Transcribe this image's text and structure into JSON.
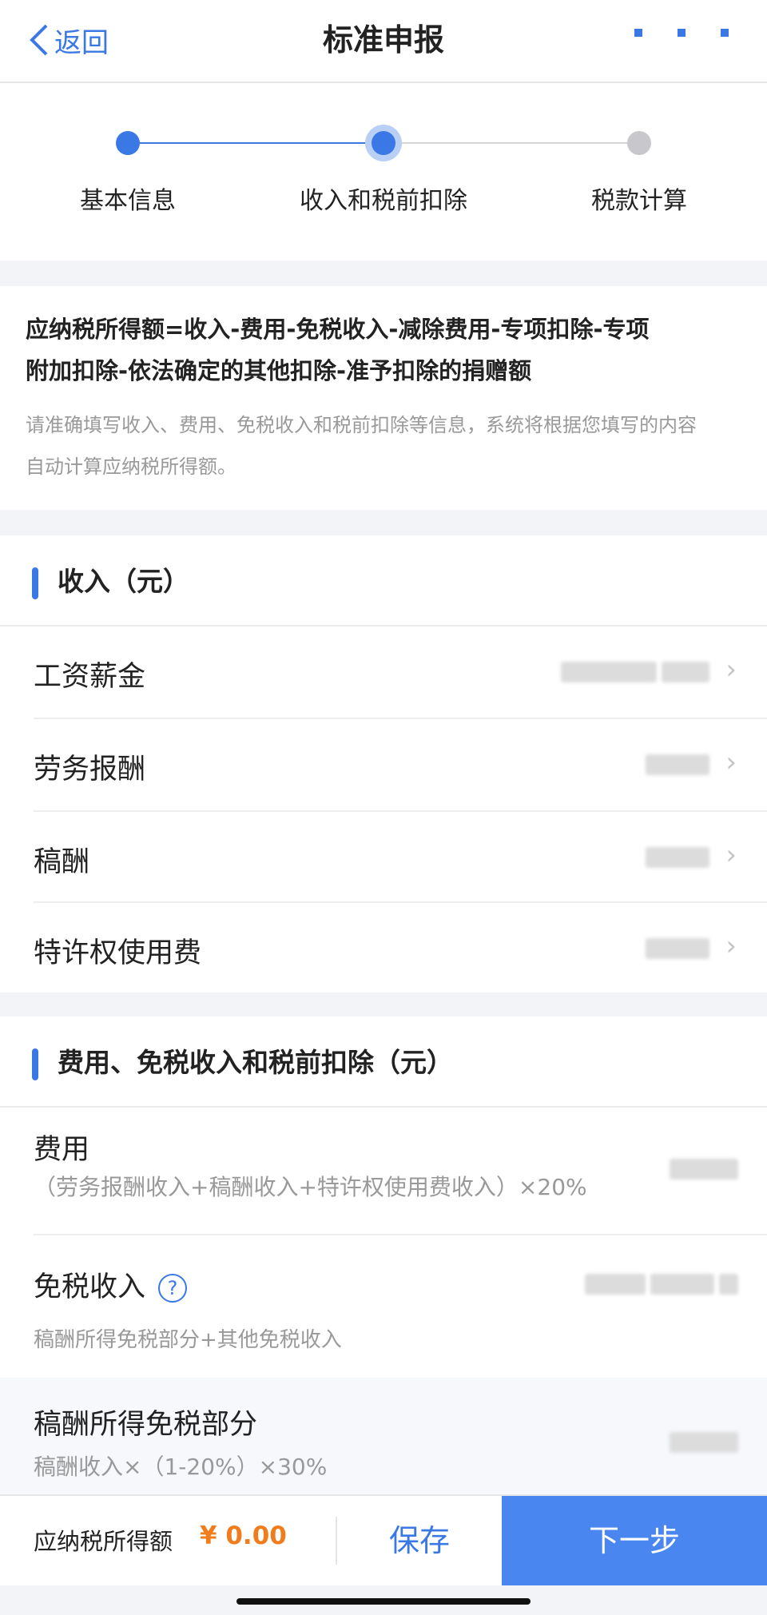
{
  "header": {
    "back_label": "返回",
    "title": "标准申报"
  },
  "steps": [
    {
      "label": "基本信息",
      "state": "done"
    },
    {
      "label": "收入和税前扣除",
      "state": "current"
    },
    {
      "label": "税款计算",
      "state": "todo"
    }
  ],
  "formula": {
    "line1": "应纳税所得额=收入-费用-免税收入-减除费用-专项扣除-专项",
    "line2": "附加扣除-依法确定的其他扣除-准予扣除的捐赠额",
    "hint1": "请准确填写收入、费用、免税收入和税前扣除等信息，系统将根据您填写的内容",
    "hint2": "自动计算应纳税所得额。"
  },
  "income": {
    "title": "收入（元）",
    "items": [
      {
        "label": "工资薪金"
      },
      {
        "label": "劳务报酬"
      },
      {
        "label": "稿酬"
      },
      {
        "label": "特许权使用费"
      }
    ]
  },
  "deductions": {
    "title": "费用、免税收入和税前扣除（元）",
    "fee": {
      "label": "费用",
      "sub": "（劳务报酬收入+稿酬收入+特许权使用费收入）×20%"
    },
    "tax_free": {
      "label": "免税收入",
      "sub": "稿酬所得免税部分+其他免税收入",
      "help": "?"
    },
    "royalty_free": {
      "label": "稿酬所得免税部分",
      "sub": "稿酬收入×（1-20%）×30%"
    }
  },
  "footer": {
    "total_label": "应纳税所得额",
    "total_value": "¥ 0.00",
    "save_label": "保存",
    "next_label": "下一步"
  },
  "colors": {
    "accent": "#3a78e6",
    "amount": "#f07c1b",
    "button": "#4a86ef"
  }
}
